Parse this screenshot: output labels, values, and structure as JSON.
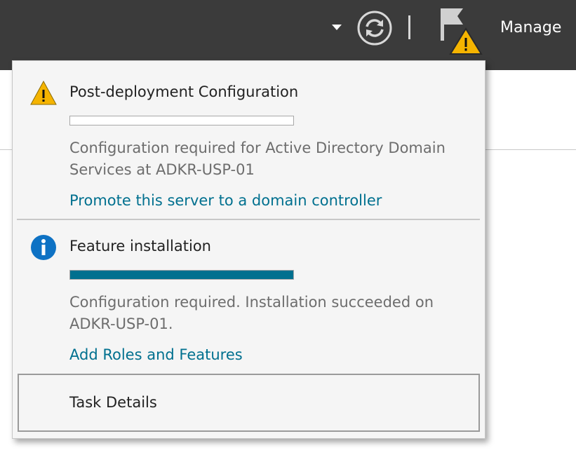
{
  "toolbar": {
    "manage_label": "Manage",
    "icons": [
      "dropdown-arrow-icon",
      "refresh-icon",
      "flag-warning-icon"
    ]
  },
  "notifications": [
    {
      "icon": "warning-icon",
      "title": "Post-deployment Configuration",
      "progress": 0,
      "description": "Configuration required for Active Directory Domain Services at ADKR-USP-01",
      "link": "Promote this server to a domain controller"
    },
    {
      "icon": "info-icon",
      "title": "Feature installation",
      "progress": 1.0,
      "description": "Configuration required. Installation succeeded on ADKR-USP-01.",
      "link": "Add Roles and Features"
    }
  ],
  "footer": {
    "task_details_label": "Task Details"
  },
  "colors": {
    "topbar": "#3b3b3b",
    "accent": "#00708f",
    "warning": "#f5b400",
    "info": "#0e72c4"
  }
}
